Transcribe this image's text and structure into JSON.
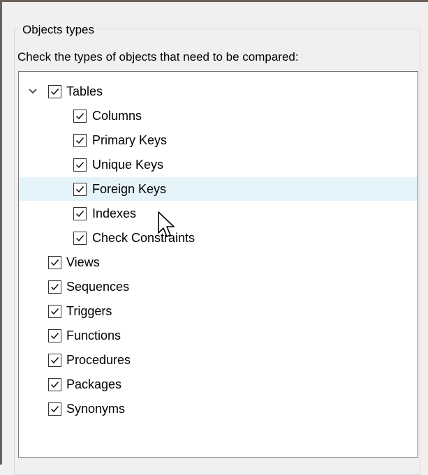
{
  "group": {
    "title": "Objects types",
    "instruction": "Check the types of objects that need to be compared:"
  },
  "tree": {
    "root": {
      "label": "Tables",
      "checked": true,
      "expanded": true
    },
    "table_children": [
      {
        "label": "Columns",
        "checked": true
      },
      {
        "label": "Primary Keys",
        "checked": true
      },
      {
        "label": "Unique Keys",
        "checked": true
      },
      {
        "label": "Foreign Keys",
        "checked": true,
        "hovered": true
      },
      {
        "label": "Indexes",
        "checked": true
      },
      {
        "label": "Check Constraints",
        "checked": true
      }
    ],
    "items": [
      {
        "label": "Views",
        "checked": true
      },
      {
        "label": "Sequences",
        "checked": true
      },
      {
        "label": "Triggers",
        "checked": true
      },
      {
        "label": "Functions",
        "checked": true
      },
      {
        "label": "Procedures",
        "checked": true
      },
      {
        "label": "Packages",
        "checked": true
      },
      {
        "label": "Synonyms",
        "checked": true
      }
    ]
  },
  "colors": {
    "hover_highlight": "#e5f3fb",
    "check_mark": "#000000"
  },
  "icons": {
    "expander": "chevron-down-icon",
    "checkbox": "checkmark-icon",
    "cursor": "arrow-pointer-icon"
  }
}
